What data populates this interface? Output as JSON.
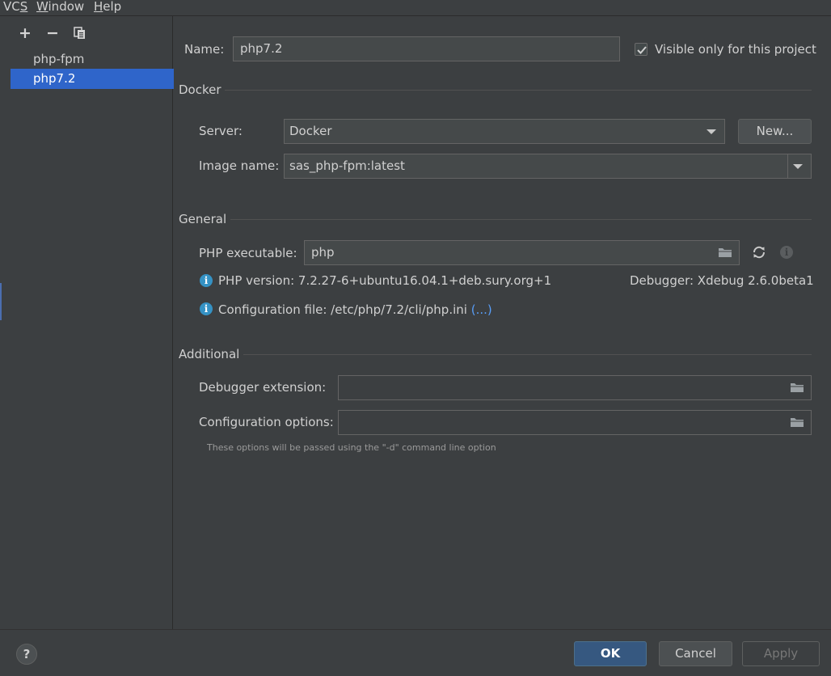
{
  "menubar": {
    "items": [
      {
        "prefix": "VC",
        "underlined": "S",
        "suffix": ""
      },
      {
        "prefix": "",
        "underlined": "W",
        "suffix": "indow"
      },
      {
        "prefix": "",
        "underlined": "H",
        "suffix": "elp"
      }
    ]
  },
  "sidebar": {
    "toolbar": {
      "add": "+",
      "remove": "−"
    },
    "items": [
      {
        "label": "php-fpm"
      },
      {
        "label": "php7.2"
      }
    ]
  },
  "form": {
    "name_label": "Name:",
    "name_value": "php7.2",
    "visible_only_label": "Visible only for this project",
    "visible_only_checked": true
  },
  "docker": {
    "title": "Docker",
    "server_label": "Server:",
    "server_value": "Docker",
    "new_button": "New...",
    "image_label": "Image name:",
    "image_value": "sas_php-fpm:latest"
  },
  "general": {
    "title": "General",
    "php_exec_label": "PHP executable:",
    "php_exec_value": "php",
    "php_version": "PHP version: 7.2.27-6+ubuntu16.04.1+deb.sury.org+1",
    "debugger": "Debugger:  Xdebug 2.6.0beta1",
    "config_file": "Configuration file: /etc/php/7.2/cli/php.ini",
    "config_link": "(...)"
  },
  "additional": {
    "title": "Additional",
    "debugger_ext_label": "Debugger extension:",
    "debugger_ext_value": "",
    "config_options_label": "Configuration options:",
    "config_options_value": "",
    "hint": "These options will be passed using the \"-d\" command line option"
  },
  "footer": {
    "help": "?",
    "ok": "OK",
    "cancel": "Cancel",
    "apply": "Apply"
  },
  "colors": {
    "background": "#3c3f41",
    "selection": "#2f65ca",
    "primary_button": "#365880",
    "info_icon": "#3592c4",
    "link": "#589df6"
  }
}
